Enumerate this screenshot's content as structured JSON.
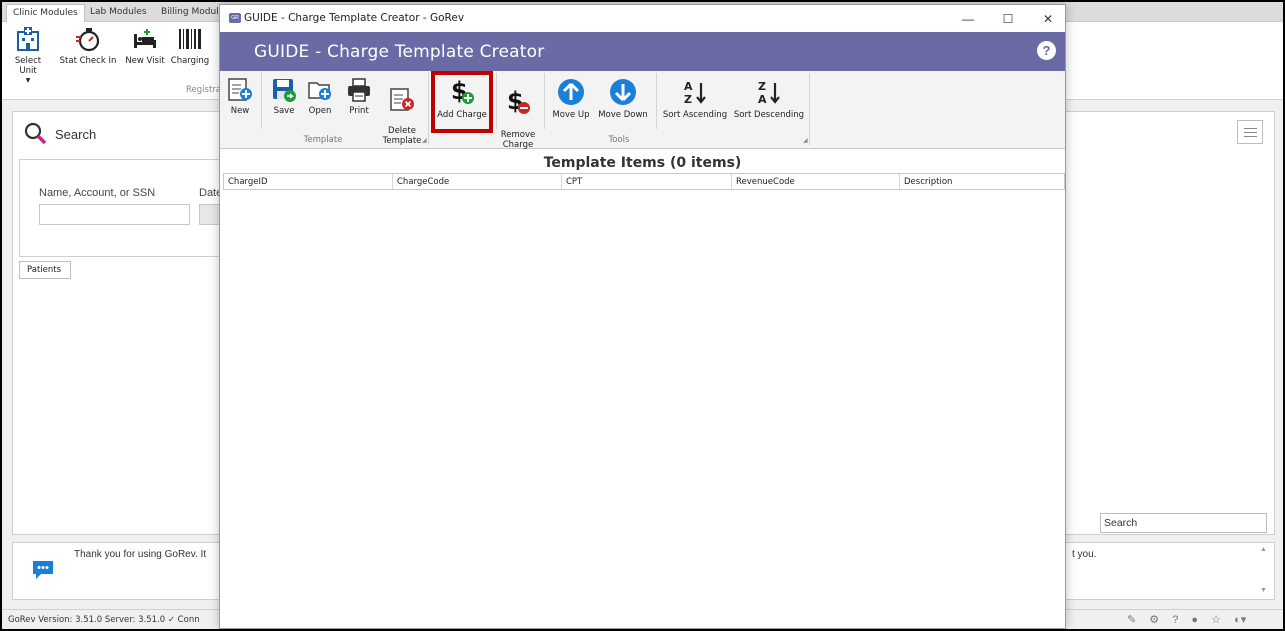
{
  "background_app": {
    "tabs": [
      "Clinic Modules",
      "Lab Modules",
      "Billing Modules"
    ],
    "ribbon_buttons": [
      "Select Unit",
      "Stat Check In",
      "New Visit",
      "Charging"
    ],
    "ribbon_group": "Registra",
    "search_title": "Search",
    "name_label": "Name, Account, or SSN",
    "date_label": "Date",
    "patients_tab": "Patients",
    "right_search_placeholder": "Search",
    "message_left": "Thank you for using GoRev.  It",
    "message_right": "t you.",
    "status": "GoRev Version: 3.51.0   Server: 3.51.0   ✓ Conn"
  },
  "dialog": {
    "window_title": "GUIDE - Charge Template Creator - GoRev",
    "header_title": "GUIDE - Charge Template Creator",
    "help_label": "?",
    "controls": {
      "minimize": "—",
      "maximize": "☐",
      "close": "✕"
    },
    "ribbon": {
      "template_group": {
        "label": "Template",
        "buttons": [
          "New",
          "Save",
          "Open",
          "Print",
          "Delete\nTemplate"
        ]
      },
      "tools_group": {
        "label": "Tools",
        "buttons": [
          "Add Charge",
          "Remove\nCharge",
          "Move Up",
          "Move Down",
          "Sort Ascending",
          "Sort Descending"
        ]
      }
    },
    "items_title": "Template Items (0 items)",
    "columns": [
      "ChargeID",
      "ChargeCode",
      "CPT",
      "RevenueCode",
      "Description"
    ]
  },
  "colors": {
    "header": "#6a6aa5",
    "highlight": "#c00000",
    "accent_blue": "#1a7fd6",
    "add_green": "#1b9b3a",
    "remove_red": "#c62828"
  }
}
